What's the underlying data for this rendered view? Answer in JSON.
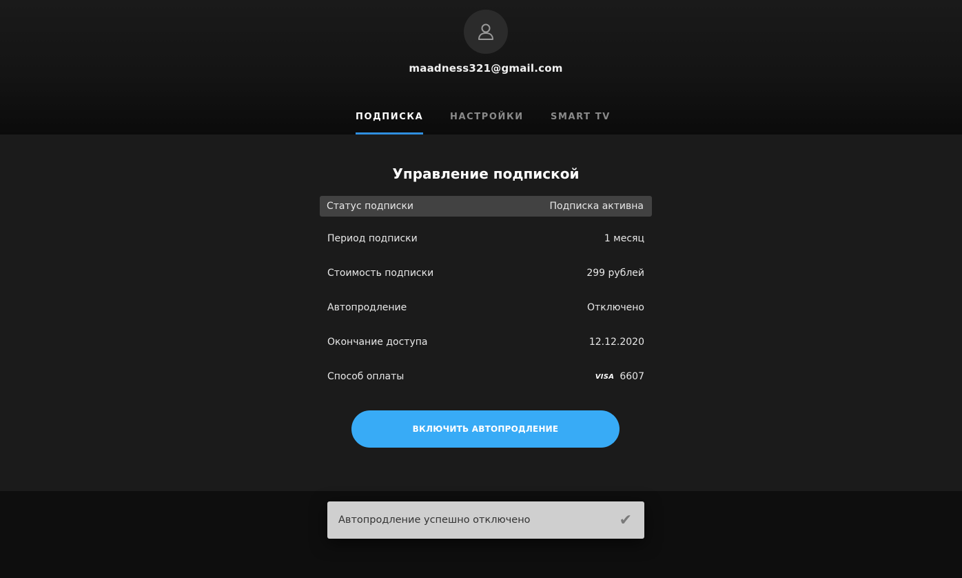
{
  "profile": {
    "email": "maadness321@gmail.com",
    "avatar_icon": "user-icon"
  },
  "tabs": [
    {
      "label": "ПОДПИСКА",
      "active": true
    },
    {
      "label": "НАСТРОЙКИ",
      "active": false
    },
    {
      "label": "SMART TV",
      "active": false
    }
  ],
  "subscription": {
    "title": "Управление подпиской",
    "status": {
      "label": "Статус подписки",
      "value": "Подписка активна"
    },
    "rows": [
      {
        "label": "Период подписки",
        "value": "1 месяц"
      },
      {
        "label": "Стоимость подписки",
        "value": "299 рублей"
      },
      {
        "label": "Автопродление",
        "value": "Отключено"
      },
      {
        "label": "Окончание доступа",
        "value": "12.12.2020"
      },
      {
        "label": "Способ оплаты",
        "value": "6607",
        "card_brand": "VISA"
      }
    ],
    "action_button": "ВКЛЮЧИТЬ АВТОПРОДЛЕНИЕ"
  },
  "toast": {
    "message": "Автопродление успешно отключено",
    "icon": "check-icon"
  },
  "colors": {
    "accent": "#38abf6",
    "tab_underline": "#2f8fe0"
  }
}
